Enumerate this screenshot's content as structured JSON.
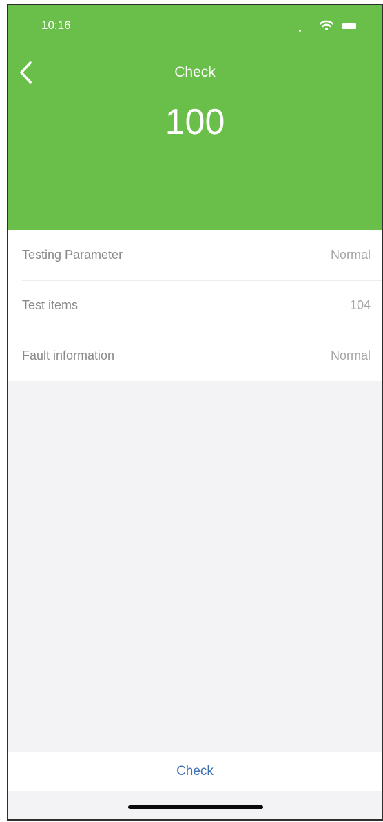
{
  "status_bar": {
    "time": "10:16",
    "icons": [
      "signal-dot-icon",
      "wifi-icon",
      "battery-icon"
    ]
  },
  "header": {
    "back_icon": "chevron-left-icon",
    "title": "Check",
    "value": "100",
    "background_color": "#6abf4b"
  },
  "list": {
    "items": [
      {
        "label": "Testing Parameter",
        "value": "Normal"
      },
      {
        "label": "Test items",
        "value": "104"
      },
      {
        "label": "Fault information",
        "value": "Normal"
      }
    ]
  },
  "footer": {
    "check_label": "Check",
    "accent_color": "#3d6fb3"
  }
}
